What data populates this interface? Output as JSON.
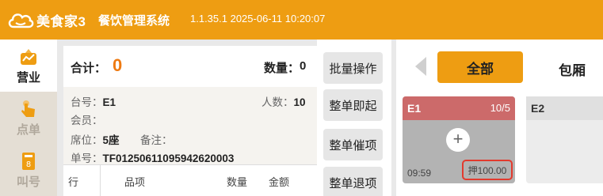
{
  "header": {
    "brand": "美食家3",
    "app_title": "餐饮管理系统",
    "version": "1.1.35.1 2025-06-11 10:20:07"
  },
  "sidebar": {
    "items": [
      {
        "label": "营业",
        "icon": "chart-icon",
        "active": true
      },
      {
        "label": "点单",
        "icon": "hand-pointer-icon",
        "active": false
      },
      {
        "label": "叫号",
        "icon": "number-ticket-icon",
        "active": false
      }
    ]
  },
  "order": {
    "total_label": "合计：",
    "total_value": "0",
    "qty_label": "数量：",
    "qty_value": "0",
    "table_label": "台号：",
    "table_value": "E1",
    "guests_label": "人数：",
    "guests_value": "10",
    "member_label": "会员：",
    "seat_label": "席位：",
    "seat_value": "5座",
    "note_label": "备注：",
    "order_no_label": "单号：",
    "order_no_value": "TF01250611095942620003",
    "columns": [
      "行",
      "品项",
      "数量",
      "金额"
    ]
  },
  "actions": [
    "批量操作",
    "整单即起",
    "整单催项",
    "整单退项"
  ],
  "area_tabs": {
    "all": "全部",
    "room": "包厢"
  },
  "tables": [
    {
      "name": "E1",
      "ratio": "10/5",
      "time": "09:59",
      "deposit": "押100.00",
      "status_color": "#cc6a6a"
    },
    {
      "name": "E2"
    }
  ],
  "colors": {
    "brand": "#ee9d12",
    "total": "#ee7a12",
    "occupied": "#cc6a6a",
    "highlight": "#e23a2e"
  }
}
